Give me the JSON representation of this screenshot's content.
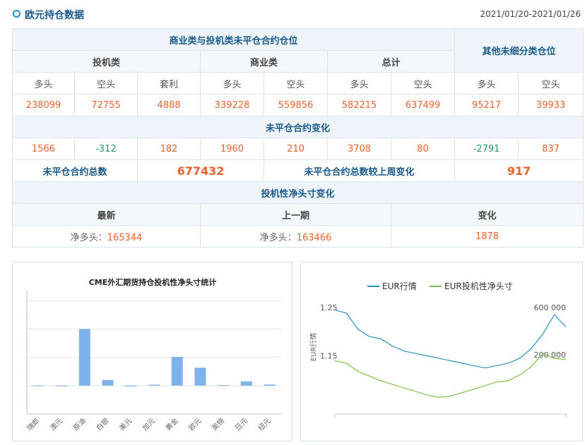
{
  "header": {
    "title": "欧元持仓数据",
    "date_range": "2021/01/20-2021/01/26"
  },
  "table": {
    "group_title": "商业类与投机类未平仓合约仓位",
    "other_title": "其他未细分类仓位",
    "groups": [
      "投机类",
      "商业类",
      "总计"
    ],
    "cols": [
      "多头",
      "空头",
      "套利",
      "多头",
      "空头",
      "多头",
      "空头",
      "多头",
      "空头"
    ],
    "values": [
      "238099",
      "72755",
      "4888",
      "339228",
      "559856",
      "582215",
      "637499",
      "95217",
      "39933"
    ],
    "change_title": "未平仓合约变化",
    "changes": [
      "1566",
      "-312",
      "182",
      "1960",
      "210",
      "3708",
      "80",
      "-2791",
      "837"
    ],
    "total_label": "未平仓合约总数",
    "total_value": "677432",
    "weekchange_label": "未平仓合约总数较上周变化",
    "weekchange_value": "917",
    "net_title": "投机性净头寸变化",
    "net_cols": [
      "最新",
      "上一期",
      "变化"
    ],
    "net_latest_prefix": "净多头：",
    "net_latest": "165344",
    "net_prev_prefix": "净多头：",
    "net_prev": "163466",
    "net_change": "1878"
  },
  "chart_data": [
    {
      "type": "bar",
      "title": "CME外汇期货持仓投机性净头寸统计",
      "categories": [
        "瑞郎",
        "澳元",
        "原油",
        "白银",
        "美元",
        "加元",
        "黄金",
        "欧元",
        "英镑",
        "日元",
        "纽元"
      ],
      "values": [
        2000,
        0,
        600000,
        60000,
        -8000,
        10000,
        305000,
        190000,
        5000,
        45000,
        12000
      ],
      "ylim": [
        -300000,
        1000000
      ],
      "color": "#7fb2ea"
    },
    {
      "type": "line",
      "series": [
        {
          "name": "EUR行情",
          "axis": "left",
          "color": "#2b91b8"
        },
        {
          "name": "EUR投机性净头寸",
          "axis": "right",
          "color": "#7cc040"
        }
      ],
      "ylabel": "EUR行情",
      "left_ticks": [
        "1.25",
        "1.15"
      ],
      "right_ticks": [
        "600 000",
        "200 000"
      ],
      "ylim_left": [
        1.03,
        1.25
      ],
      "ylim_right": [
        -300000,
        600000
      ],
      "x": [
        0,
        5,
        10,
        15,
        20,
        25,
        30,
        35,
        40,
        45,
        50,
        55,
        60,
        65,
        70,
        75,
        80,
        85,
        90,
        95,
        100
      ],
      "eur": [
        1.245,
        1.238,
        1.205,
        1.19,
        1.185,
        1.17,
        1.16,
        1.155,
        1.15,
        1.145,
        1.14,
        1.135,
        1.13,
        1.125,
        1.13,
        1.135,
        1.145,
        1.165,
        1.195,
        1.235,
        1.21
      ],
      "net": [
        150000,
        130000,
        60000,
        20000,
        -20000,
        -50000,
        -80000,
        -110000,
        -140000,
        -160000,
        -150000,
        -120000,
        -90000,
        -60000,
        -30000,
        -20000,
        30000,
        100000,
        210000,
        170000,
        160000
      ]
    }
  ]
}
